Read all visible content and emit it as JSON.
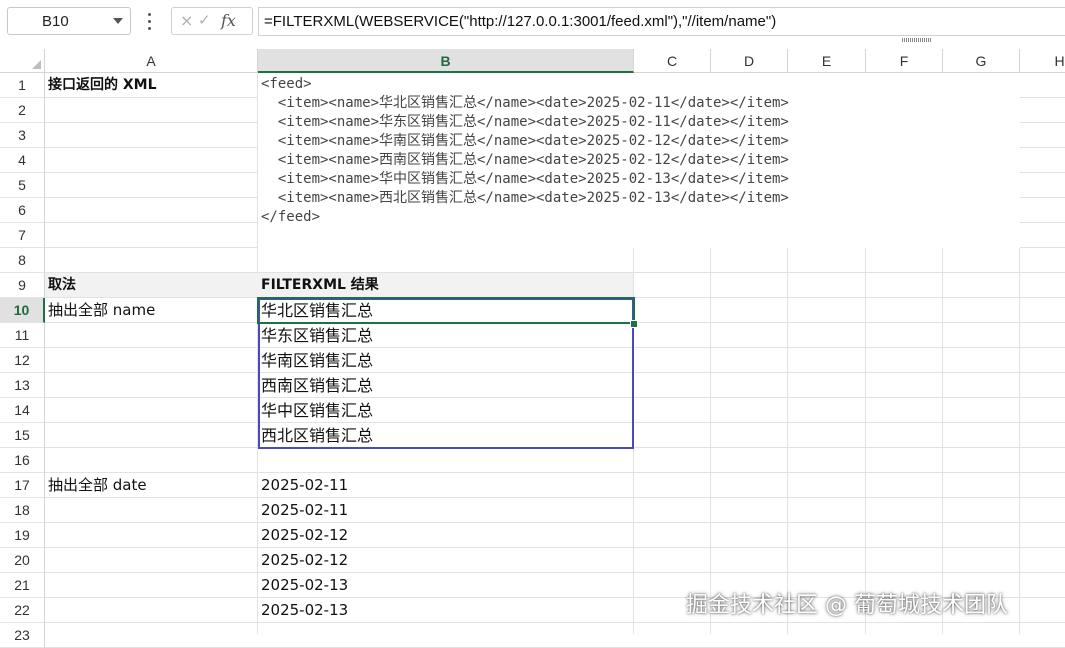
{
  "formula_bar": {
    "name_box": "B10",
    "cancel_icon": "×",
    "confirm_icon": "✓",
    "fx_label": "fx",
    "formula": "=FILTERXML(WEBSERVICE(\"http://127.0.0.1:3001/feed.xml\"),\"//item/name\")"
  },
  "columns": [
    "A",
    "B",
    "C",
    "D",
    "E",
    "F",
    "G",
    "H"
  ],
  "rows": [
    "1",
    "2",
    "3",
    "4",
    "5",
    "6",
    "7",
    "8",
    "9",
    "10",
    "11",
    "12",
    "13",
    "14",
    "15",
    "16",
    "17",
    "18",
    "19",
    "20",
    "21",
    "22",
    "23"
  ],
  "cells": {
    "A1": "接口返回的 XML",
    "A9": "取法",
    "B9": "FILTERXML 结果",
    "A10": "抽出全部 name",
    "A17": "抽出全部 date"
  },
  "xml_lines": [
    "<feed>",
    "  <item><name>华北区销售汇总</name><date>2025-02-11</date></item>",
    "  <item><name>华东区销售汇总</name><date>2025-02-11</date></item>",
    "  <item><name>华南区销售汇总</name><date>2025-02-12</date></item>",
    "  <item><name>西南区销售汇总</name><date>2025-02-12</date></item>",
    "  <item><name>华中区销售汇总</name><date>2025-02-13</date></item>",
    "  <item><name>西北区销售汇总</name><date>2025-02-13</date></item>",
    "</feed>"
  ],
  "names": [
    "华北区销售汇总",
    "华东区销售汇总",
    "华南区销售汇总",
    "西南区销售汇总",
    "华中区销售汇总",
    "西北区销售汇总"
  ],
  "dates": [
    "2025-02-11",
    "2025-02-11",
    "2025-02-12",
    "2025-02-12",
    "2025-02-13",
    "2025-02-13"
  ],
  "watermark": "掘金技术社区 @ 葡萄城技术团队",
  "colors": {
    "selection": "#1e7145",
    "spill_border": "#4a4ac0",
    "header_bg": "#e1e1e1"
  }
}
